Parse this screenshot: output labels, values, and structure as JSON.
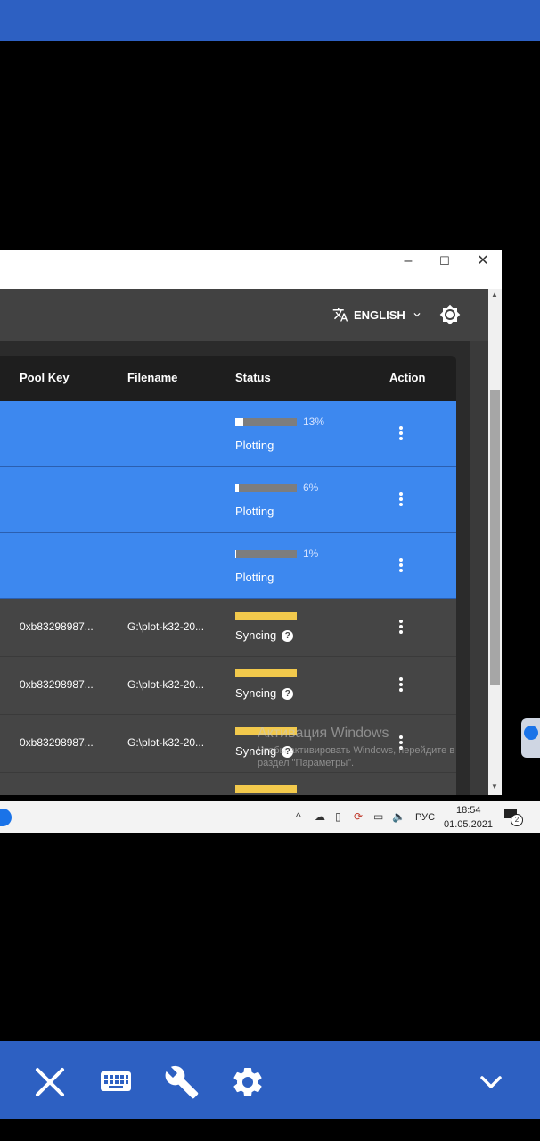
{
  "window": {
    "minimize": "–",
    "maximize": "☐",
    "close": "✕"
  },
  "header": {
    "language": "ENGLISH"
  },
  "table": {
    "columns": {
      "pool_key": "Pool Key",
      "filename": "Filename",
      "status": "Status",
      "action": "Action"
    },
    "plotting_rows": [
      {
        "progress": 0.13,
        "percent": "13%",
        "status": "Plotting"
      },
      {
        "progress": 0.06,
        "percent": "6%",
        "status": "Plotting"
      },
      {
        "progress": 0.01,
        "percent": "1%",
        "status": "Plotting"
      }
    ],
    "synced_rows": [
      {
        "pool_key": "0xb83298987...",
        "filename": "G:\\plot-k32-20...",
        "status": "Syncing"
      },
      {
        "pool_key": "0xb83298987...",
        "filename": "G:\\plot-k32-20...",
        "status": "Syncing"
      },
      {
        "pool_key": "0xb83298987...",
        "filename": "G:\\plot-k32-20...",
        "status": "Syncing"
      }
    ]
  },
  "watermark": {
    "title": "Активация Windows",
    "line1": "Чтобы активировать Windows, перейдите в",
    "line2": "раздел \"Параметры\"."
  },
  "taskbar": {
    "language": "РУС",
    "time": "18:54",
    "date": "01.05.2021",
    "notifications": "2"
  },
  "colors": {
    "accent": "#2d60c2",
    "row_selected": "#3d88ef",
    "sync_bar": "#f2c94c"
  }
}
